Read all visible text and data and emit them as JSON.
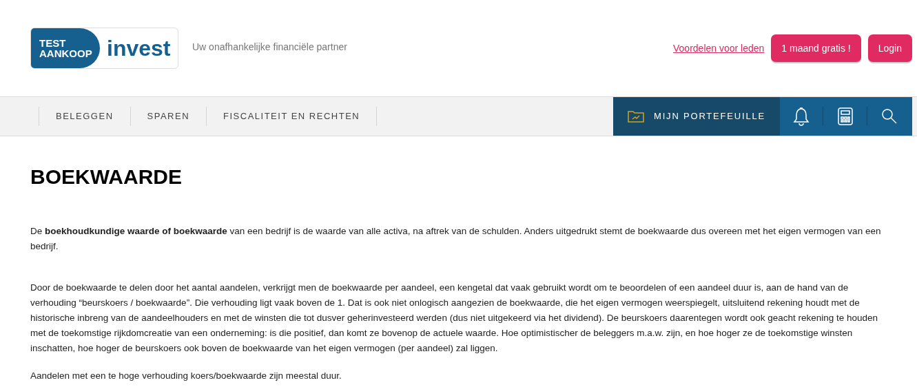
{
  "header": {
    "logo": {
      "top_line": "TEST",
      "bottom_line": "AANKOOP",
      "word": "invest"
    },
    "tagline": "Uw onafhankelijke financiële partner",
    "link": "Voordelen voor leden",
    "buttons": [
      {
        "label": "1 maand gratis !"
      },
      {
        "label": "Login"
      }
    ]
  },
  "nav": {
    "items": [
      {
        "label": "BELEGGEN"
      },
      {
        "label": "SPAREN"
      },
      {
        "label": "FISCALITEIT EN RECHTEN"
      }
    ],
    "portfolio": "MIJN PORTEFEUILLE"
  },
  "article": {
    "title": "BOEKWAARDE",
    "paragraphs": [
      "De **boekhoudkundige waarde of boekwaarde** van een bedrijf is de waarde van alle activa, na aftrek van de schulden. Anders uitgedrukt stemt de boekwaarde dus overeen met het eigen vermogen van een bedrijf.",
      "Door de boekwaarde te delen door het aantal aandelen, verkrijgt men de boekwaarde per aandeel, een kengetal dat vaak gebruikt wordt om te beoordelen of een aandeel duur is, aan de hand van de verhouding “beurskoers / boekwaarde”. Die verhouding ligt vaak boven de 1. Dat is ook niet onlogisch aangezien de boekwaarde, die het eigen vermogen weerspiegelt, uitsluitend rekening houdt met de historische inbreng van de aandeelhouders en met de winsten die tot dusver geherinvesteerd werden (dus niet uitgekeerd via het dividend). De beurskoers daarentegen wordt ook geacht rekening te houden met de toekomstige rijkdomcreatie van een onderneming: is die positief, dan komt ze bovenop de actuele waarde. Hoe optimistischer de beleggers m.a.w. zijn, en hoe hoger ze de toekomstige winsten inschatten, hoe hoger de beurskoers ook boven de boekwaarde van het eigen vermogen (per aandeel) zal liggen.",
      "Aandelen met een te hoge verhouding koers/boekwaarde zijn meestal duur."
    ]
  }
}
